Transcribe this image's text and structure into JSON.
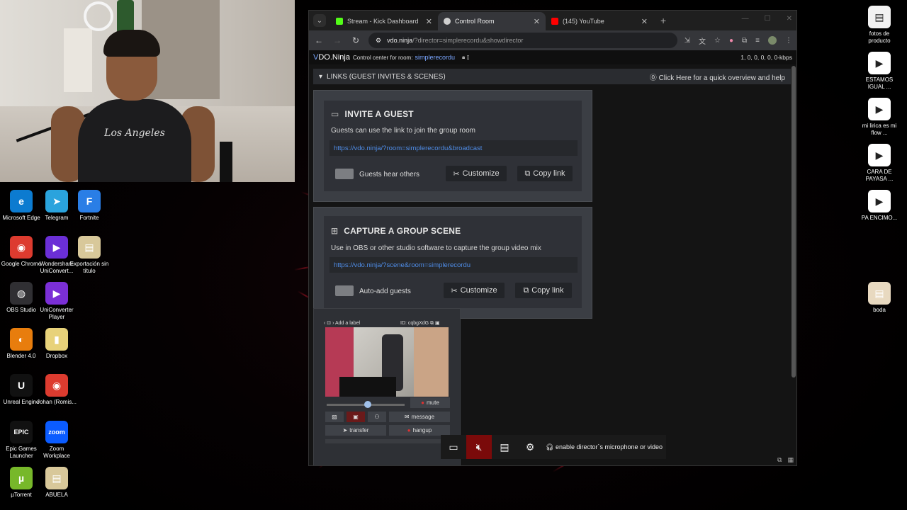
{
  "browser": {
    "tabs": [
      {
        "label": "Stream - Kick Dashboard",
        "color": "#53fc18"
      },
      {
        "label": "Control Room",
        "color": "#cccccc",
        "active": true
      },
      {
        "label": "(145) YouTube",
        "color": "#ff0000"
      }
    ],
    "url_host": "vdo.ninja",
    "url_path": "/?director=simplerecordu&showdirector"
  },
  "vdo": {
    "brand_prefix": "V",
    "brand_rest": "DO.Ninja",
    "control_label": "Control center for room:",
    "room_name": "simplerecordu",
    "stats": "1, 0, 0, 0, 0, 0-kbps",
    "links_header": "LINKS (GUEST INVITES & SCENES)",
    "help_text": "Click Here for a quick overview and help"
  },
  "invite": {
    "title": "INVITE A GUEST",
    "desc": "Guests can use the link to join the group room",
    "link": "https://vdo.ninja/?room=simplerecordu&broadcast",
    "toggle_label": "Guests hear others",
    "customize": "Customize",
    "copy": "Copy link"
  },
  "scene": {
    "title": "CAPTURE A GROUP SCENE",
    "desc": "Use in OBS or other studio software to capture the group video mix",
    "link": "https://vdo.ninja/?scene&room=simplerecordu",
    "toggle_label": "Auto-add guests",
    "customize": "Customize",
    "copy": "Copy link"
  },
  "guest": {
    "add_label": "Add a label",
    "id": "ID: cqbgXdG",
    "mute": "mute",
    "message": "message",
    "transfer": "transfer",
    "hangup": "hangup"
  },
  "floatbar": {
    "mic_text": "enable director`s microphone or video"
  },
  "desktop_left": [
    {
      "label": "Microsoft Edge",
      "bg": "#0c7bd0",
      "glyph": "e"
    },
    {
      "label": "Telegram",
      "bg": "#2aa3dd",
      "glyph": "➤"
    },
    {
      "label": "Fortnite",
      "bg": "#2a7ee6",
      "glyph": "F"
    },
    {
      "label": "Google Chrome",
      "bg": "#dd3b2f",
      "glyph": "◉"
    },
    {
      "label": "Wondershare UniConvert...",
      "bg": "#6b2fd6",
      "glyph": "▶"
    },
    {
      "label": "Exportación sin título",
      "bg": "#d8c89a",
      "glyph": "▤"
    },
    {
      "label": "OBS Studio",
      "bg": "#302f33",
      "glyph": "◍"
    },
    {
      "label": "UniConverter Player",
      "bg": "#7b2fd6",
      "glyph": "▶"
    },
    {
      "label": "Blender 4.0",
      "bg": "#e87d0d",
      "glyph": "◐"
    },
    {
      "label": "Dropbox",
      "bg": "#e8d27a",
      "glyph": "▮"
    },
    {
      "label": "Unreal Engine",
      "bg": "#111111",
      "glyph": "U"
    },
    {
      "label": "Johan (Romis...",
      "bg": "#dd3b2f",
      "glyph": "◉"
    },
    {
      "label": "Epic Games Launcher",
      "bg": "#111111",
      "glyph": "EPIC"
    },
    {
      "label": "Zoom Workplace",
      "bg": "#0b5cff",
      "glyph": "zoom"
    },
    {
      "label": "µTorrent",
      "bg": "#77b82a",
      "glyph": "µ"
    },
    {
      "label": "ABUELA",
      "bg": "#d8c89a",
      "glyph": "▤"
    }
  ],
  "desktop_right": [
    {
      "label": "fotos de producto",
      "bg": "#f2f2f2",
      "glyph": "▤"
    },
    {
      "label": "ESTAMOS IGUAL ...",
      "bg": "#ffffff",
      "glyph": "▶"
    },
    {
      "label": "mi lirica es mi flow ...",
      "bg": "#ffffff",
      "glyph": "▶"
    },
    {
      "label": "CARA DE PAYASA ...",
      "bg": "#ffffff",
      "glyph": "▶"
    },
    {
      "label": "PA ENCIMO...",
      "bg": "#ffffff",
      "glyph": "▶"
    },
    {
      "label": "boda",
      "bg": "#e8d9c0",
      "glyph": "▤"
    }
  ]
}
